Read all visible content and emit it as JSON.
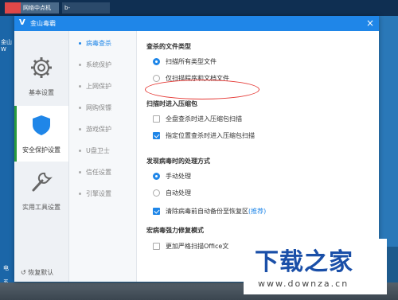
{
  "desktop": {
    "tabs": [
      "",
      "网络中点机",
      "b-"
    ],
    "left_label": "金山W",
    "left_items": [
      "电",
      "系"
    ]
  },
  "window": {
    "title": "金山毒霸",
    "close": "×"
  },
  "rail": {
    "items": [
      {
        "label": "基本设置",
        "icon": "gear-icon"
      },
      {
        "label": "安全保护设置",
        "icon": "shield-icon"
      },
      {
        "label": "实用工具设置",
        "icon": "wrench-icon"
      }
    ],
    "restore_label": "恢复默认"
  },
  "subnav": {
    "items": [
      "病毒查杀",
      "系统保护",
      "上网保护",
      "网购保镖",
      "游戏保护",
      "U盘卫士",
      "信任设置",
      "引擎设置"
    ],
    "selected": 0
  },
  "content": {
    "scan_types": {
      "heading": "查杀的文件类型",
      "options": [
        "扫描所有类型文件",
        "仅扫描程序和文档文件"
      ]
    },
    "archives": {
      "heading": "扫描时进入压缩包",
      "options": [
        "全盘查杀时进入压缩包扫描",
        "指定位置查杀时进入压缩包扫描"
      ]
    },
    "handling": {
      "heading": "发现病毒时的处理方式",
      "options": [
        "手动处理",
        "自动处理"
      ],
      "backup": "清除病毒前自动备份至恢复区",
      "backup_note": "(推荐)"
    },
    "repair": {
      "heading": "宏病毒强力修复模式",
      "option": "更加严格扫描Office文"
    }
  },
  "watermark": {
    "title": "下载之家",
    "url": "www.downza.cn"
  },
  "colors": {
    "accent": "#1f86e8",
    "titlebar": "#1f86e8",
    "highlight": "#e53935",
    "selected_marker": "#2a9b3d"
  }
}
